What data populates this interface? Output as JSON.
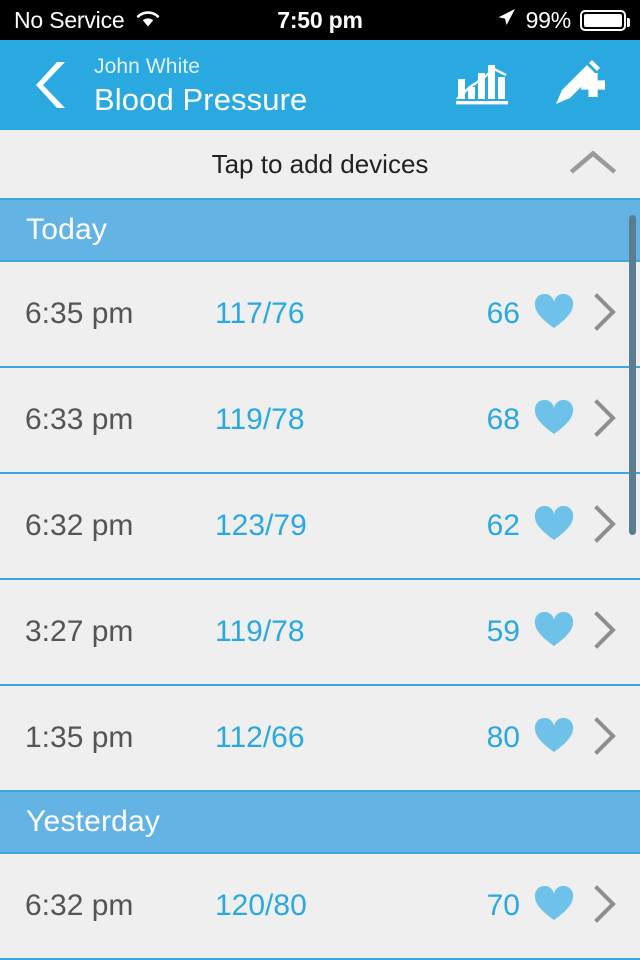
{
  "status_bar": {
    "carrier": "No Service",
    "wifi_icon": "wifi-icon",
    "time": "7:50 pm",
    "location_icon": "location-arrow-icon",
    "battery_percent": "99%",
    "battery_icon": "battery-full-icon"
  },
  "nav": {
    "back_icon": "chevron-left-icon",
    "subtitle": "John White",
    "title": "Blood Pressure",
    "chart_icon": "bar-chart-icon",
    "add_entry_icon": "pencil-plus-icon"
  },
  "devices": {
    "label": "Tap to add devices",
    "collapse_icon": "chevron-up-icon"
  },
  "sections": [
    {
      "title": "Today",
      "rows": [
        {
          "time": "6:35 pm",
          "bp": "117/76",
          "pulse": "66",
          "heart_icon": "heart-icon",
          "disclosure_icon": "chevron-right-icon"
        },
        {
          "time": "6:33 pm",
          "bp": "119/78",
          "pulse": "68",
          "heart_icon": "heart-icon",
          "disclosure_icon": "chevron-right-icon"
        },
        {
          "time": "6:32 pm",
          "bp": "123/79",
          "pulse": "62",
          "heart_icon": "heart-icon",
          "disclosure_icon": "chevron-right-icon"
        },
        {
          "time": "3:27 pm",
          "bp": "119/78",
          "pulse": "59",
          "heart_icon": "heart-icon",
          "disclosure_icon": "chevron-right-icon"
        },
        {
          "time": "1:35 pm",
          "bp": "112/66",
          "pulse": "80",
          "heart_icon": "heart-icon",
          "disclosure_icon": "chevron-right-icon"
        }
      ]
    },
    {
      "title": "Yesterday",
      "rows": [
        {
          "time": "6:32 pm",
          "bp": "120/80",
          "pulse": "70",
          "heart_icon": "heart-icon",
          "disclosure_icon": "chevron-right-icon"
        }
      ]
    }
  ],
  "colors": {
    "nav_blue": "#29a9e0",
    "section_blue": "#63b4e5",
    "separator_blue": "#3fa9dc",
    "row_background": "#efefef",
    "value_blue": "#29a9e0",
    "heart_blue": "#6ec2ea",
    "time_gray": "#555555",
    "chevron_gray": "#8e8e8e",
    "scrollbar": "#5b7d93",
    "status_bar_background": "#000000"
  }
}
